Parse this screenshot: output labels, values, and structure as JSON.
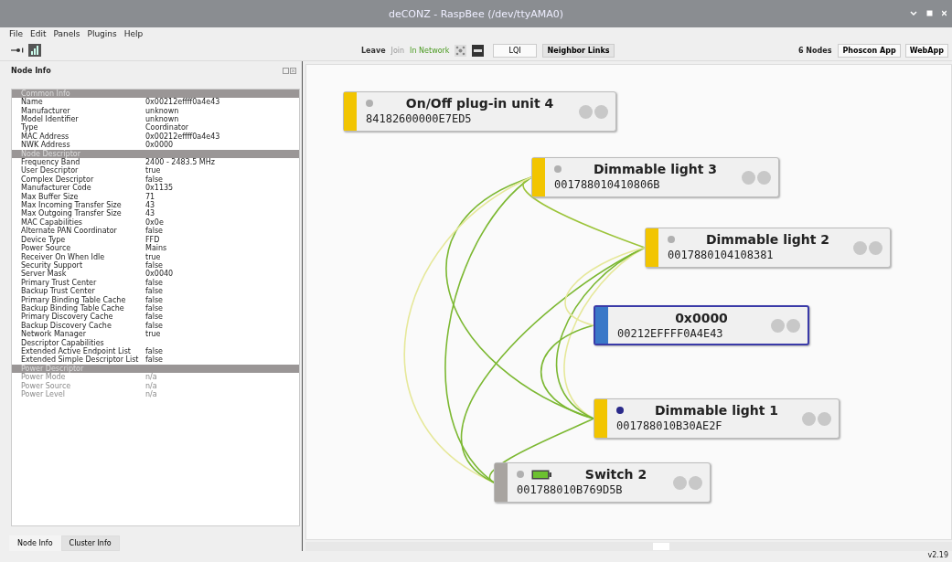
{
  "window": {
    "title": "deCONZ - RaspBee (/dev/ttyAMA0)"
  },
  "menu": [
    "File",
    "Edit",
    "Panels",
    "Plugins",
    "Help"
  ],
  "toolbar": {
    "actions": [
      {
        "label": "Leave",
        "kind": "normal"
      },
      {
        "label": "Join",
        "kind": "disabled"
      },
      {
        "label": "In Network",
        "kind": "status"
      }
    ],
    "view_buttons": [
      {
        "label": "LQI",
        "selected": false
      },
      {
        "label": "Neighbor Links",
        "selected": true
      }
    ],
    "node_count": "6 Nodes",
    "apps": [
      "Phoscon App",
      "WebApp"
    ]
  },
  "panel": {
    "title": "Node Info",
    "sections": [
      {
        "title": "Common Info",
        "rows": [
          {
            "label": "Name",
            "value": "0x00212effff0a4e43",
            "disabled": false
          },
          {
            "label": "Manufacturer",
            "value": "unknown",
            "disabled": false
          },
          {
            "label": "Model Identifier",
            "value": "unknown",
            "disabled": false
          },
          {
            "label": "Type",
            "value": "Coordinator",
            "disabled": false
          },
          {
            "label": "MAC Address",
            "value": "0x00212effff0a4e43",
            "disabled": false
          },
          {
            "label": "NWK Address",
            "value": "0x0000",
            "disabled": false
          }
        ]
      },
      {
        "title": "Node Descriptor",
        "rows": [
          {
            "label": "Frequency Band",
            "value": "2400 - 2483.5 MHz",
            "disabled": false
          },
          {
            "label": "User Descriptor",
            "value": "true",
            "disabled": false
          },
          {
            "label": "Complex Descriptor",
            "value": "false",
            "disabled": false
          },
          {
            "label": "Manufacturer Code",
            "value": "0x1135",
            "disabled": false
          },
          {
            "label": "Max Buffer Size",
            "value": "71",
            "disabled": false
          },
          {
            "label": "Max Incoming Transfer Size",
            "value": "43",
            "disabled": false
          },
          {
            "label": "Max Outgoing Transfer Size",
            "value": "43",
            "disabled": false
          },
          {
            "label": "MAC Capabilities",
            "value": "0x0e",
            "disabled": false
          },
          {
            "label": "Alternate PAN Coordinator",
            "value": "false",
            "disabled": false
          },
          {
            "label": "Device Type",
            "value": "FFD",
            "disabled": false
          },
          {
            "label": "Power Source",
            "value": "Mains",
            "disabled": false
          },
          {
            "label": "Receiver On When Idle",
            "value": "true",
            "disabled": false
          },
          {
            "label": "Security Support",
            "value": "false",
            "disabled": false
          },
          {
            "label": "Server Mask",
            "value": "0x0040",
            "disabled": false
          },
          {
            "label": "Primary Trust Center",
            "value": "false",
            "disabled": false
          },
          {
            "label": "Backup Trust Center",
            "value": "false",
            "disabled": false
          },
          {
            "label": "Primary Binding Table Cache",
            "value": "false",
            "disabled": false
          },
          {
            "label": "Backup Binding Table Cache",
            "value": "false",
            "disabled": false
          },
          {
            "label": "Primary Discovery Cache",
            "value": "false",
            "disabled": false
          },
          {
            "label": "Backup Discovery Cache",
            "value": "false",
            "disabled": false
          },
          {
            "label": "Network Manager",
            "value": "true",
            "disabled": false
          },
          {
            "label": "Descriptor Capabilities",
            "disabled": false
          },
          {
            "label": "Extended Active Endpoint List",
            "value": "false",
            "disabled": false
          },
          {
            "label": "Extended Simple Descriptor List",
            "value": "false",
            "disabled": false
          }
        ]
      },
      {
        "title": "Power Descriptor",
        "rows": [
          {
            "label": "Power Mode",
            "value": "n/a",
            "disabled": true
          },
          {
            "label": "Power Source",
            "value": "n/a",
            "disabled": true
          },
          {
            "label": "Power Level",
            "value": "n/a",
            "disabled": true
          }
        ]
      }
    ],
    "tabs": [
      {
        "label": "Node Info",
        "selected": true
      },
      {
        "label": "Cluster Info",
        "selected": false
      }
    ]
  },
  "nodes": [
    {
      "name": "On/Off plug-in unit 4",
      "address": "84182600000E7ED5",
      "color": "#f2c500",
      "selected": false,
      "kind": "router",
      "active": false
    },
    {
      "name": "Dimmable light 3",
      "address": "001788010410806B",
      "color": "#f2c500",
      "selected": false,
      "kind": "router",
      "active": false
    },
    {
      "name": "Dimmable light 2",
      "address": "0017880104108381",
      "color": "#f2c500",
      "selected": false,
      "kind": "router",
      "active": false
    },
    {
      "name": "0x0000",
      "address": "00212EFFFF0A4E43",
      "color": "#3a78c8",
      "selected": true,
      "kind": "coordinator"
    },
    {
      "name": "Dimmable light 1",
      "address": "001788010B30AE2F",
      "color": "#f2c500",
      "selected": false,
      "kind": "router",
      "active": true
    },
    {
      "name": "Switch 2",
      "address": "001788010B769D5B",
      "color": "#a8a4a0",
      "selected": false,
      "kind": "battery",
      "active": false
    }
  ],
  "status": "v2.19"
}
